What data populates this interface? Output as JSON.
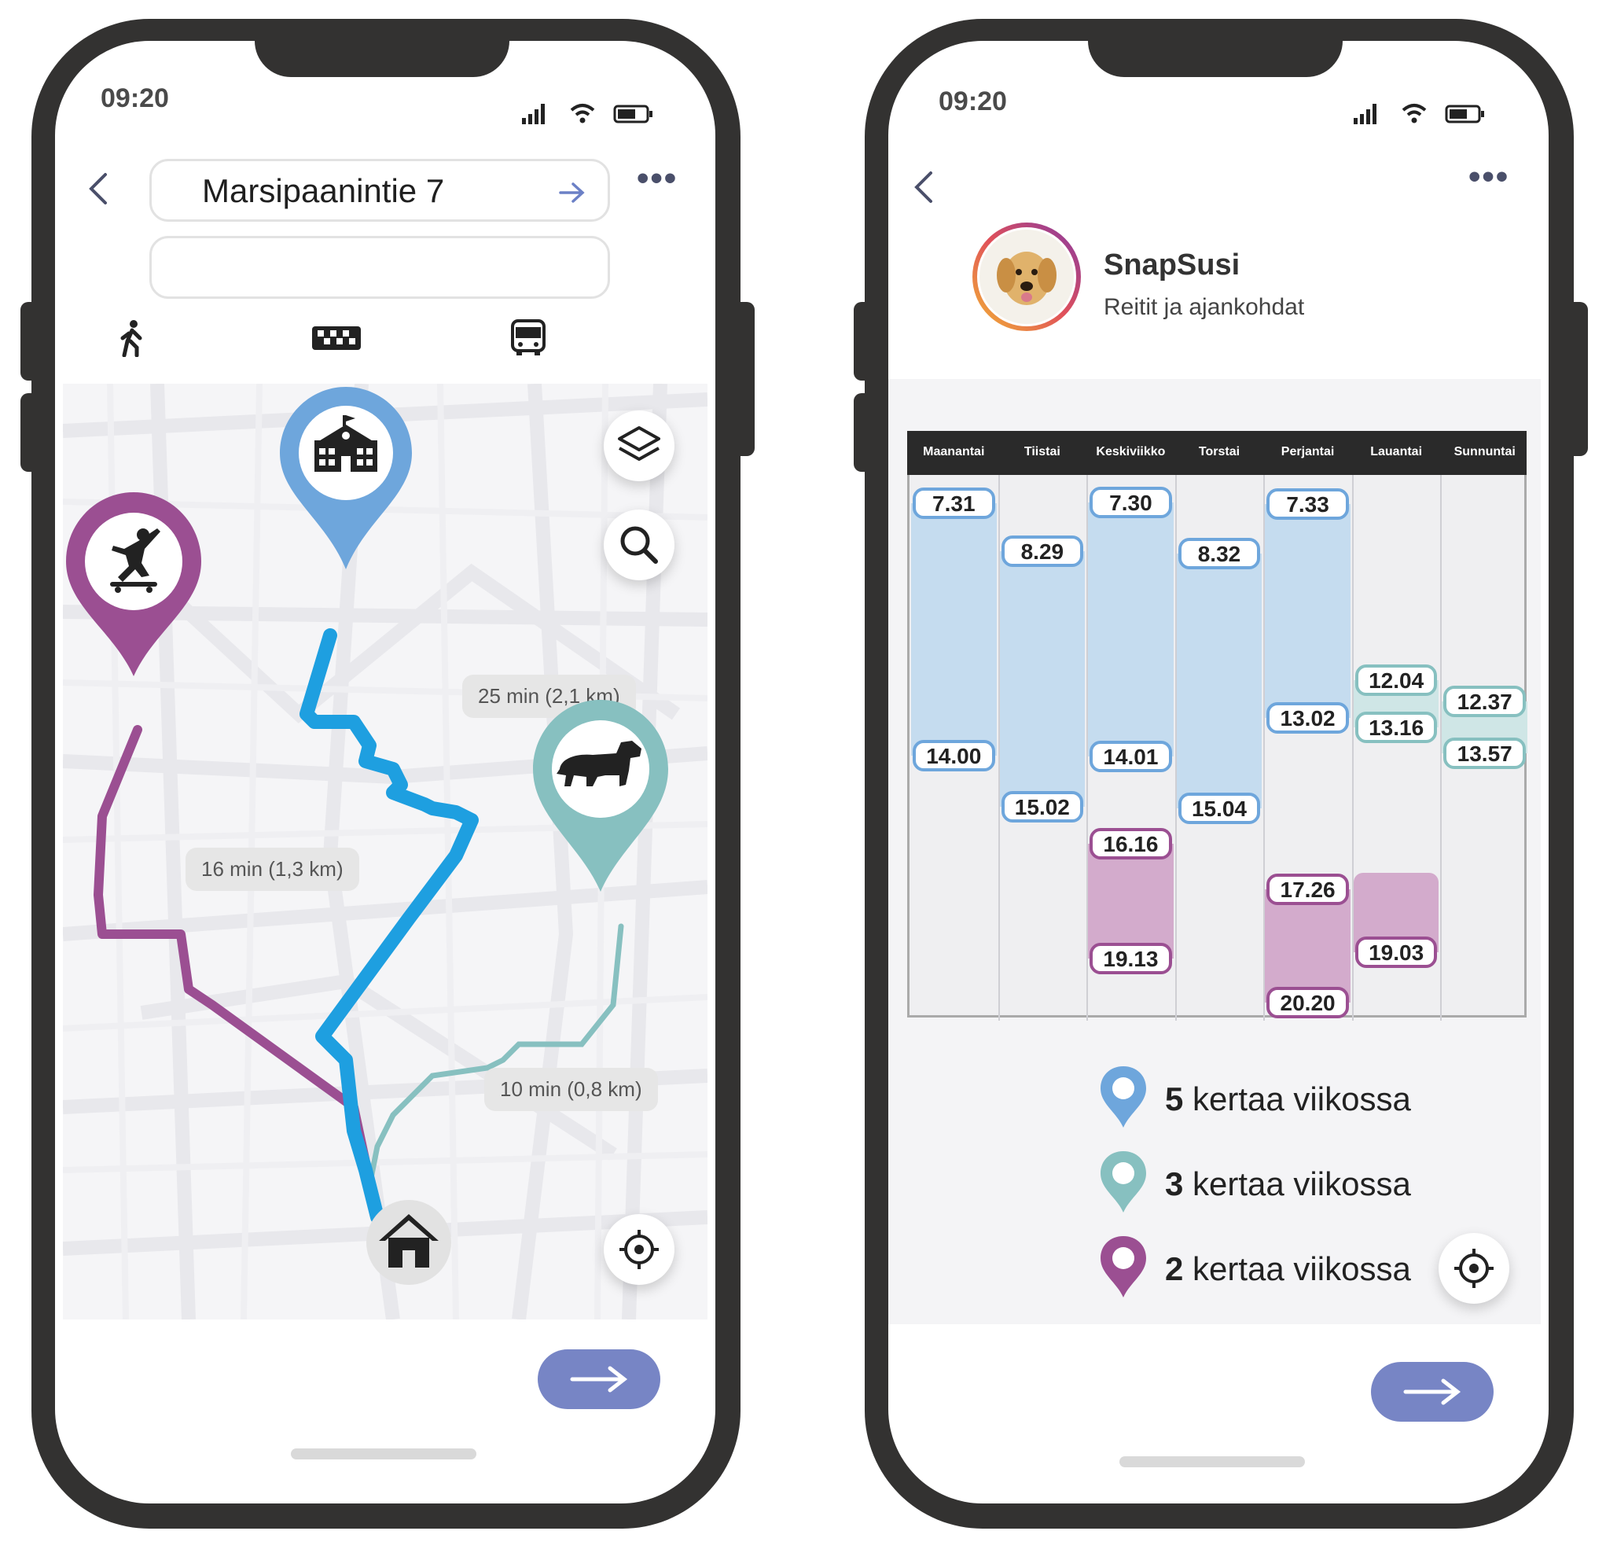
{
  "left_phone": {
    "status_time": "09:20",
    "search": {
      "destination_value": "Marsipaanintie 7",
      "second_value": ""
    },
    "transport_modes": [
      "walk-icon",
      "taxi-icon",
      "bus-icon"
    ],
    "routes": [
      {
        "destination": "school",
        "label": "25 min (2,1 km)",
        "color": "#1e9fe0"
      },
      {
        "destination": "skatepark",
        "label": "16 min (1,3 km)",
        "color": "#9b4f92"
      },
      {
        "destination": "dog-park",
        "label": "10 min (0,8 km)",
        "color": "#87c0c0"
      }
    ]
  },
  "right_phone": {
    "status_time": "09:20",
    "profile": {
      "name": "SnapSusi",
      "subtitle": "Reitit ja ajankohdat"
    },
    "chart_data": {
      "type": "table",
      "days": [
        "Maanantai",
        "Tiistai",
        "Keskiviikko",
        "Torstai",
        "Perjantai",
        "Lauantai",
        "Sunnuntai"
      ],
      "blue": [
        {
          "start": "7.31",
          "end": "14.00"
        },
        {
          "start": "8.29",
          "end": "15.02"
        },
        {
          "start": "7.30",
          "end": "14.01"
        },
        {
          "start": "8.32",
          "end": "15.04"
        },
        {
          "start": "7.33",
          "end": "13.02"
        },
        null,
        null
      ],
      "teal": [
        null,
        null,
        null,
        null,
        null,
        {
          "start": "12.04",
          "end": "13.16"
        },
        {
          "start": "12.37",
          "end": "13.57"
        }
      ],
      "purple": [
        null,
        null,
        {
          "start": "16.16",
          "end": "19.13"
        },
        null,
        {
          "start": "17.26",
          "end": "20.20"
        },
        {
          "start": "",
          "end": "19.03"
        },
        null
      ]
    },
    "legend": [
      {
        "count": "5",
        "text": "kertaa viikossa",
        "color": "#6ea6dc"
      },
      {
        "count": "3",
        "text": "kertaa viikossa",
        "color": "#87c0c0"
      },
      {
        "count": "2",
        "text": "kertaa viikossa",
        "color": "#9b4f92"
      }
    ]
  },
  "colors": {
    "frame": "#333231",
    "accent_button": "#7785c5",
    "blue_fill": "#c5dcef",
    "teal_fill": "#cfe6e6",
    "purple_fill": "#d3abcc"
  }
}
